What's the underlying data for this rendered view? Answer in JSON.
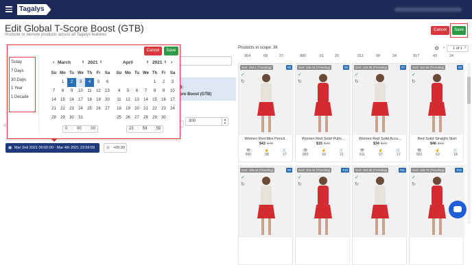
{
  "app": {
    "brand": "Tagalys"
  },
  "page": {
    "title": "Edit Global T-Score Boost (GTB)",
    "subtitle": "Promote or demote products across all Tagalys features"
  },
  "header_buttons": {
    "cancel": "Cancel",
    "save": "Save"
  },
  "picker": {
    "cancel": "Cancel",
    "save": "Save",
    "presets": [
      "Today",
      "7 Days",
      "30 Days",
      "1 Year",
      "1 Decade"
    ],
    "dow": [
      "Su",
      "Mo",
      "Tu",
      "We",
      "Th",
      "Fr",
      "Sa"
    ],
    "left": {
      "month": "March",
      "year": "2021",
      "days": [
        "",
        "1",
        "2",
        "3",
        "4",
        "5",
        "6",
        "7",
        "8",
        "9",
        "10",
        "11",
        "12",
        "13",
        "14",
        "15",
        "16",
        "17",
        "18",
        "19",
        "20",
        "21",
        "22",
        "23",
        "24",
        "25",
        "26",
        "27",
        "28",
        "29",
        "30",
        "31",
        "",
        "",
        ""
      ],
      "time": [
        "0",
        "00",
        "00"
      ]
    },
    "right": {
      "month": "April",
      "year": "2021",
      "days": [
        "",
        "",
        "",
        "",
        "1",
        "2",
        "3",
        "4",
        "5",
        "6",
        "7",
        "8",
        "9",
        "10",
        "11",
        "12",
        "13",
        "14",
        "15",
        "16",
        "17",
        "18",
        "19",
        "20",
        "21",
        "22",
        "23",
        "24",
        "25",
        "26",
        "27",
        "28",
        "29",
        "30",
        ""
      ],
      "time": [
        "23",
        "59",
        "59"
      ]
    }
  },
  "form": {
    "section_frag": "3:",
    "section_title_frag": "ore Boost (GTB)",
    "boost_value": "300",
    "date_range": "Mar 2nd 2021 00:00:00 - Mar 4th 2021 23:59:59",
    "timezone": "+05:30",
    "left_frag": "-0"
  },
  "scope": {
    "label": "Products in scope: 36",
    "page": "1 of 1"
  },
  "top_row_numbers": [
    "954",
    "68",
    "27",
    "900",
    "51",
    "20",
    "911",
    "58",
    "24",
    "917",
    "43",
    "24"
  ],
  "products": [
    {
      "tag": "Sort: 164.1 (Trending)",
      "pos": "#5",
      "name": "Women Red Mini Pencil...",
      "price": "$43",
      "old": "$49",
      "stats": [
        "890",
        "58",
        "27"
      ]
    },
    {
      "tag": "Sort: 156.43 (Trending)",
      "pos": "#6",
      "name": "Women Red Solid Pullo...",
      "price": "$15",
      "old": "$20",
      "stats": [
        "959",
        "59",
        "21"
      ]
    },
    {
      "tag": "Sort: 156.36 (Trending)",
      "pos": "#7",
      "name": "Women Red Solid Acco...",
      "price": "$34",
      "old": "$76",
      "stats": [
        "911",
        "57",
        "17"
      ]
    },
    {
      "tag": "Sort: 153.66 (Trending)",
      "pos": "#8",
      "name": "Red Solid Straight Skirt",
      "price": "$46",
      "old": "$66",
      "stats": [
        "903",
        "63",
        "18"
      ]
    },
    {
      "tag": "Sort: 155.19 (Trending)",
      "pos": "#9"
    },
    {
      "tag": "Sort: 153.44 (Trending)",
      "pos": "#10"
    },
    {
      "tag": "Sort: 152.68 (Trending)",
      "pos": "#11"
    },
    {
      "tag": "Sort: 149.76 (Trending)",
      "pos": "#12"
    }
  ],
  "colors": {
    "nav": "#1d2a57",
    "accent_blue": "#2a6fb4",
    "cancel": "#d9363e",
    "save": "#2e9a47",
    "product_red": "#d42a32"
  }
}
